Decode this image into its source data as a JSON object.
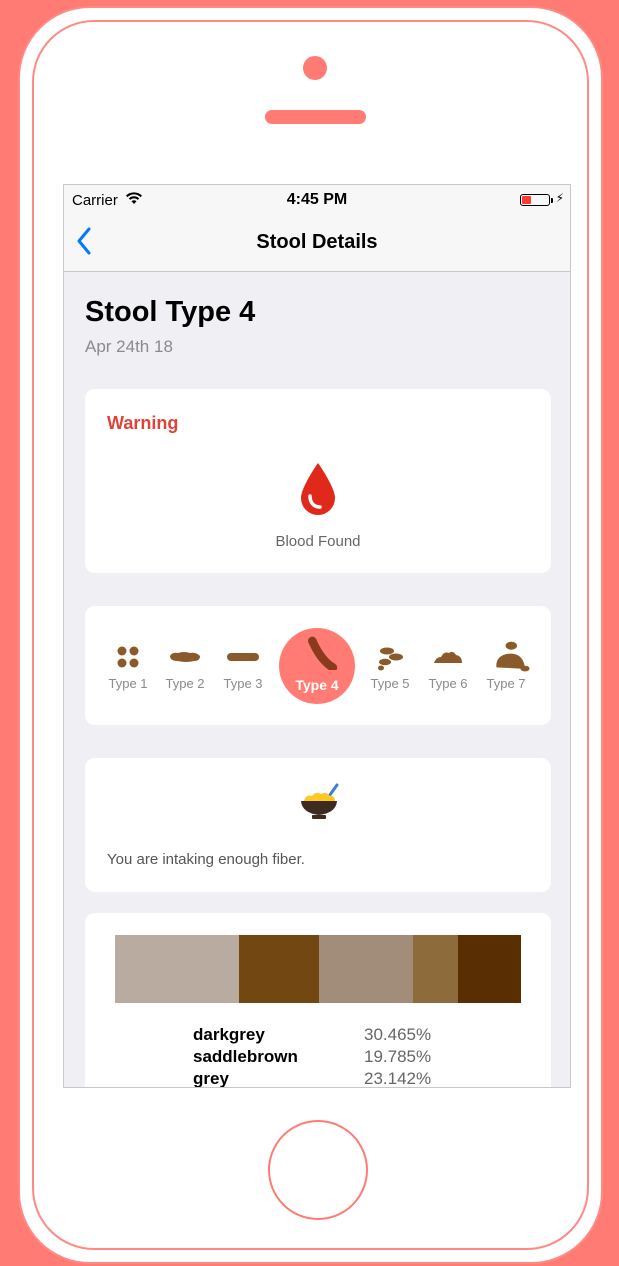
{
  "status_bar": {
    "carrier": "Carrier",
    "time": "4:45 PM"
  },
  "nav": {
    "back_icon": "chevron-left-icon",
    "title": "Stool Details"
  },
  "header": {
    "title": "Stool Type 4",
    "date": "Apr 24th 18"
  },
  "warning": {
    "label": "Warning",
    "icon": "blood-drop-icon",
    "caption": "Blood Found"
  },
  "types": {
    "selected": 3,
    "items": [
      {
        "label": "Type 1"
      },
      {
        "label": "Type 2"
      },
      {
        "label": "Type 3"
      },
      {
        "label": "Type 4"
      },
      {
        "label": "Type 5"
      },
      {
        "label": "Type 6"
      },
      {
        "label": "Type 7"
      }
    ]
  },
  "fiber": {
    "icon": "cereal-bowl-icon",
    "message": "You are intaking enough fiber."
  },
  "colors": {
    "swatches": [
      {
        "color": "#b9ab9f",
        "share": 0.305
      },
      {
        "color": "#734711",
        "share": 0.198
      },
      {
        "color": "#a28d7a",
        "share": 0.231
      },
      {
        "color": "#8e6b3b",
        "share": 0.11
      },
      {
        "color": "#582e02",
        "share": 0.156
      }
    ],
    "rows": [
      {
        "name": "darkgrey",
        "percent": "30.465%"
      },
      {
        "name": "saddlebrown",
        "percent": "19.785%"
      },
      {
        "name": "grey",
        "percent": "23.142%"
      }
    ]
  },
  "theme": {
    "accent": "#ff7b74",
    "link": "#007aff",
    "warning": "#e0433a",
    "stool": "#8b5a2b"
  }
}
